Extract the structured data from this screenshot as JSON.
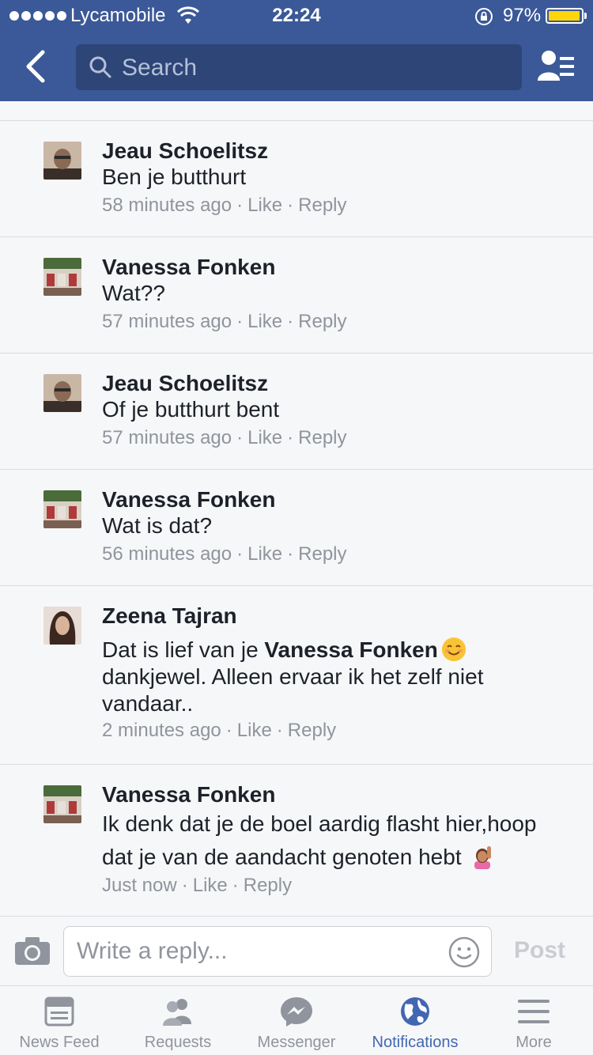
{
  "status_bar": {
    "carrier": "Lycamobile",
    "time": "22:24",
    "battery": "97%",
    "battery_color": "#ffd60a"
  },
  "nav": {
    "search_placeholder": "Search",
    "bar_color": "#3b5998"
  },
  "comments": [
    {
      "author": "Jeau Schoelitsz",
      "text": "Ben je butthurt",
      "time": "58 minutes ago",
      "like": "Like",
      "reply": "Reply"
    },
    {
      "author": "Vanessa Fonken",
      "text": "Wat??",
      "time": "57 minutes ago",
      "like": "Like",
      "reply": "Reply"
    },
    {
      "author": "Jeau Schoelitsz",
      "text": "Of je butthurt bent",
      "time": "57 minutes ago",
      "like": "Like",
      "reply": "Reply"
    },
    {
      "author": "Vanessa Fonken",
      "text": "Wat is dat?",
      "time": "56 minutes ago",
      "like": "Like",
      "reply": "Reply"
    },
    {
      "author": "Zeena Tajran",
      "text_prefix": "Dat is lief van je",
      "mention": "Vanessa Fonken",
      "text_suffix": "dankjewel. Alleen ervaar ik het zelf niet vandaar..",
      "emoji": "smiling-face-emoji",
      "time": "2 minutes ago",
      "like": "Like",
      "reply": "Reply"
    },
    {
      "author": "Vanessa Fonken",
      "text": "Ik denk dat je de boel aardig flasht hier,hoop dat je van de aandacht genoten hebt",
      "emoji": "raising-hand-emoji",
      "time": "Just now",
      "like": "Like",
      "reply": "Reply"
    }
  ],
  "reply_bar": {
    "placeholder": "Write a reply...",
    "post_label": "Post"
  },
  "tabs": [
    {
      "label": "News Feed",
      "icon": "news-feed-icon",
      "active": false
    },
    {
      "label": "Requests",
      "icon": "requests-icon",
      "active": false
    },
    {
      "label": "Messenger",
      "icon": "messenger-icon",
      "active": false
    },
    {
      "label": "Notifications",
      "icon": "globe-icon",
      "active": true
    },
    {
      "label": "More",
      "icon": "menu-icon",
      "active": false
    }
  ],
  "colors": {
    "accent": "#4267b2",
    "meta_text": "#90949c"
  }
}
